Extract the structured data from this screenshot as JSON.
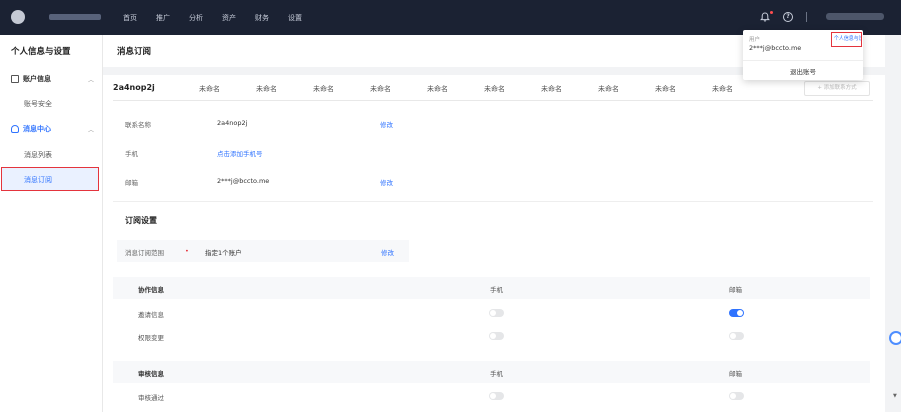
{
  "topnav": {
    "items": [
      "首页",
      "推广",
      "分析",
      "资产",
      "财务",
      "设置"
    ],
    "help_glyph": "?"
  },
  "sidebar": {
    "title": "个人信息与设置",
    "groups": [
      {
        "label": "账户信息",
        "icon": "account-icon",
        "items": [
          "账号安全"
        ]
      },
      {
        "label": "消息中心",
        "icon": "bell-icon",
        "items": [
          "消息列表",
          "消息订阅"
        ]
      }
    ]
  },
  "main": {
    "title": "消息订阅",
    "tabs": [
      "2a4nop2j",
      "未命名",
      "未命名",
      "未命名",
      "未命名",
      "未命名",
      "未命名",
      "未命名",
      "未命名",
      "未命名",
      "未命名"
    ],
    "add_contact": "+ 添加联系方式",
    "contact": {
      "name_label": "联系名称",
      "name_value": "2a4nop2j",
      "name_edit": "修改",
      "phone_label": "手机",
      "phone_value": "点击添加手机号",
      "email_label": "邮箱",
      "email_value": "2***j@bccto.me",
      "email_edit": "修改"
    },
    "subscription": {
      "title": "订阅设置",
      "scope_label": "消息订阅范围",
      "scope_required": "•",
      "scope_value": "指定1个账户",
      "scope_edit": "修改",
      "sections": [
        {
          "name": "协作信息",
          "col_phone": "手机",
          "col_email": "邮箱",
          "rows": [
            {
              "label": "邀请信息",
              "phone": false,
              "email": true
            },
            {
              "label": "权限变更",
              "phone": false,
              "email": false
            }
          ]
        },
        {
          "name": "审核信息",
          "col_phone": "手机",
          "col_email": "邮箱",
          "rows": [
            {
              "label": "审核通过",
              "phone": false,
              "email": false
            }
          ]
        }
      ]
    }
  },
  "dropdown": {
    "user_label": "用户",
    "email": "2***j@bccto.me",
    "settings": "个人信息与设置",
    "logout": "退出账号"
  },
  "colors": {
    "accent": "#2f73ff",
    "nav_bg": "#1b2233",
    "highlight": "#e4343d"
  }
}
